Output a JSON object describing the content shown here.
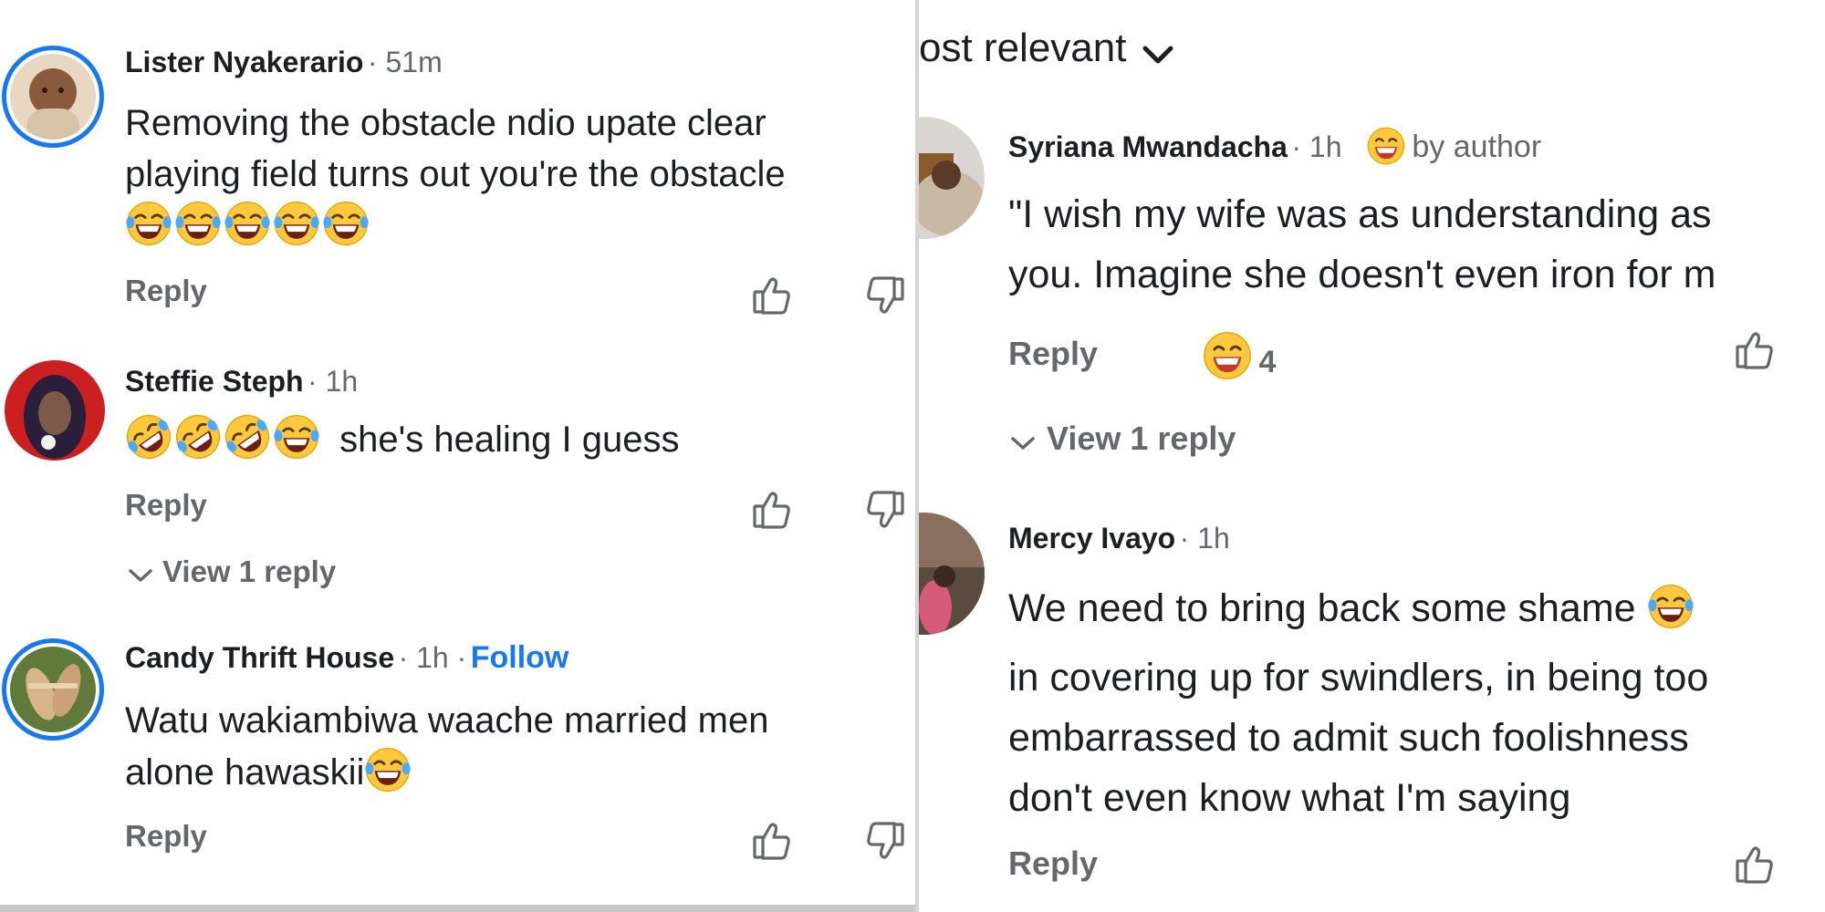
{
  "sort": {
    "label": "ost relevant"
  },
  "left_comments": [
    {
      "author": "Lister Nyakerario",
      "meta": "· 51m",
      "text_lines": [
        "Removing the obstacle ndio upate clear",
        "playing field turns out you're the obstacle"
      ],
      "emojis": [
        "laughing-tears",
        "laughing-tears",
        "laughing-tears",
        "laughing-tears",
        "laughing-tears"
      ],
      "reply_label": "Reply"
    },
    {
      "author": "Steffie Steph",
      "meta": "· 1h",
      "text": "she's healing I guess",
      "emojis_before_text": [
        "rolling-laughing",
        "rolling-laughing",
        "rolling-laughing",
        "laughing-tears"
      ],
      "reply_label": "Reply",
      "view_replies_label": "View 1 reply"
    },
    {
      "author": "Candy Thrift House",
      "meta": "· 1h ·",
      "follow_label": "Follow",
      "text_lines": [
        "Watu wakiambiwa waache married men",
        "alone hawaskii"
      ],
      "trailing_emoji": "laughing-tears",
      "reply_label": "Reply"
    }
  ],
  "right_comments": [
    {
      "author": "Syriana Mwandacha",
      "meta": "· 1h",
      "badge": "by author",
      "badge_emoji": "grinning-sweat",
      "text_lines": [
        "\"I wish my wife was as understanding as",
        "you. Imagine she doesn't even iron for m"
      ],
      "reply_label": "Reply",
      "reaction_emoji": "grinning-sweat",
      "reaction_count": "4",
      "view_replies_label": "View 1 reply"
    },
    {
      "author": "Mercy Ivayo",
      "meta": "· 1h",
      "text_lines": [
        "We need to bring back some shame",
        "in covering up for swindlers, in being too",
        "embarrassed to admit such foolishness",
        "don't even know what I'm saying"
      ],
      "line1_emoji": "laughing-tears",
      "reply_label": "Reply"
    }
  ],
  "colors": {
    "accent": "#1877f2",
    "muted_text": "#65676b",
    "primary_text": "#1c1e21",
    "emoji_yellow": "#ffc83d"
  },
  "icons": {
    "like": "thumbs-up-icon",
    "dislike": "thumbs-down-icon",
    "chevron": "chevron-down-icon"
  }
}
